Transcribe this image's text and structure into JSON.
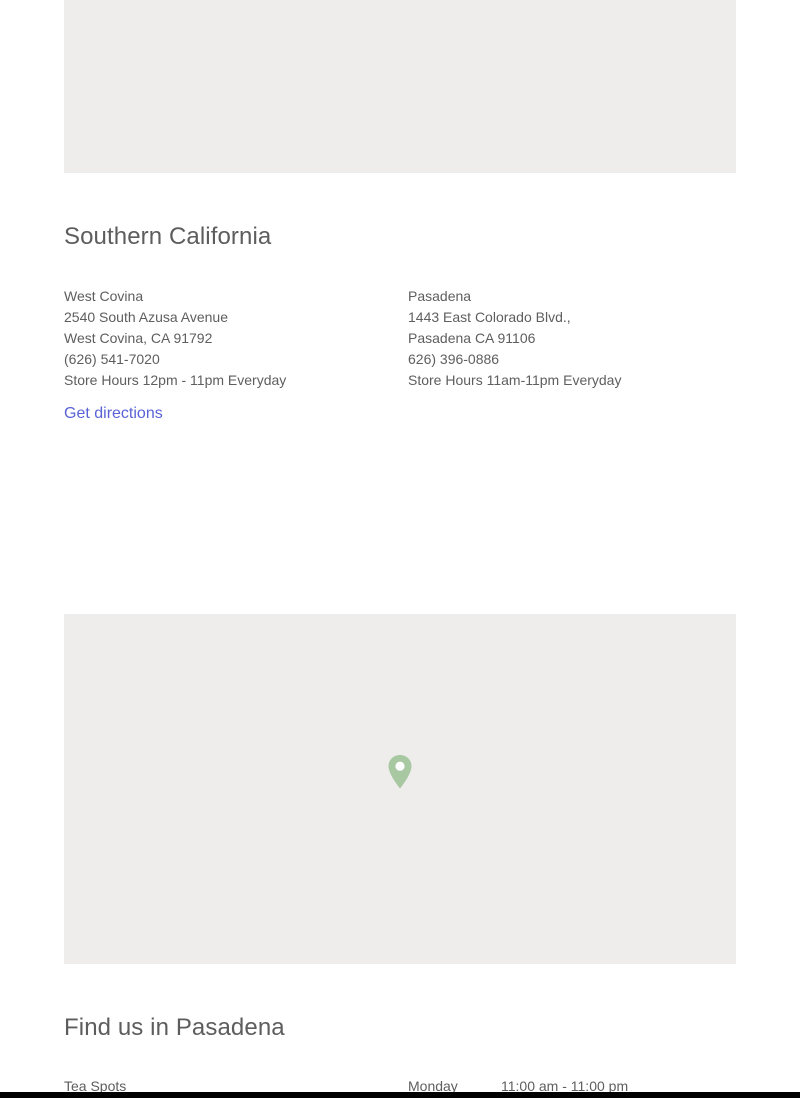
{
  "map_top": {},
  "region": {
    "title": "Southern California"
  },
  "stores": [
    {
      "name": "West Covina",
      "address1": "2540 South Azusa Avenue",
      "address2": "West Covina, CA 91792",
      "phone": "(626) 541-7020",
      "hours": "Store Hours 12pm - 11pm Everyday",
      "directions_label": "Get directions"
    },
    {
      "name": "Pasadena",
      "address1": "1443 East Colorado Blvd.,",
      "address2": "Pasadena CA 91106",
      "phone": "626) 396-0886",
      "hours": "Store Hours 11am-11pm Everyday"
    }
  ],
  "map_bottom": {
    "pin_icon": "map-pin-icon",
    "pin_color": "#a8c8a2",
    "background": "#eeedeb"
  },
  "find_us": {
    "title": "Find us in Pasadena",
    "left_label": "Tea Spots",
    "day": "Monday",
    "hours": "11:00 am - 11:00 pm"
  },
  "colors": {
    "link": "#5a63d6",
    "text": "#5e5e5e",
    "heading": "#5d5d5d"
  }
}
